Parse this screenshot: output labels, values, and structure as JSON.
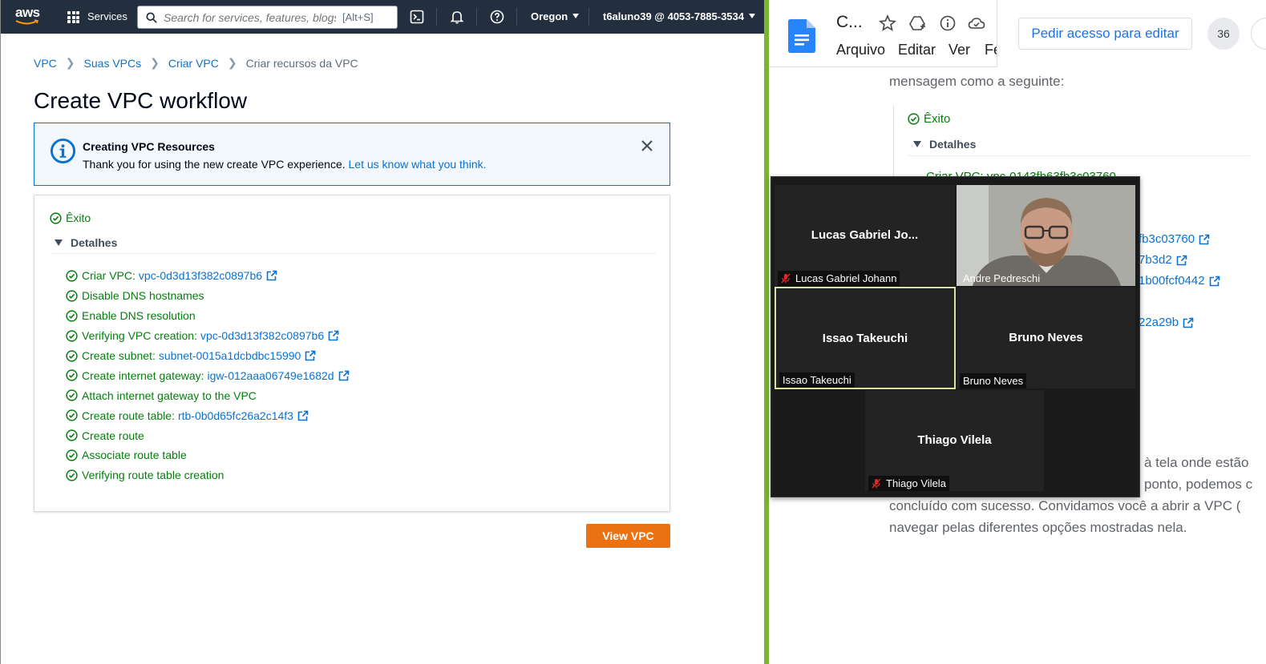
{
  "aws_nav": {
    "logo_text": "aws",
    "services": "Services",
    "search_placeholder": "Search for services, features, blogs, docs",
    "search_shortcut": "[Alt+S]",
    "region": "Oregon",
    "account": "t6aluno39 @ 4053-7885-3534"
  },
  "breadcrumb": {
    "items": [
      "VPC",
      "Suas VPCs",
      "Criar VPC"
    ],
    "current": "Criar recursos da VPC"
  },
  "page_title": "Create VPC workflow",
  "flash": {
    "title": "Creating VPC Resources",
    "body": "Thank you for using the new create VPC experience. ",
    "link": "Let us know what you think."
  },
  "result": {
    "status": "Êxito",
    "details_label": "Detalhes",
    "steps": [
      {
        "text": "Criar VPC:",
        "link": "vpc-0d3d13f382c0897b6"
      },
      {
        "text": "Disable DNS hostnames",
        "link": ""
      },
      {
        "text": "Enable DNS resolution",
        "link": ""
      },
      {
        "text": "Verifying VPC creation:",
        "link": "vpc-0d3d13f382c0897b6"
      },
      {
        "text": "Create subnet:",
        "link": "subnet-0015a1dcbdbc15990"
      },
      {
        "text": "Create internet gateway:",
        "link": "igw-012aaa06749e1682d"
      },
      {
        "text": "Attach internet gateway to the VPC",
        "link": ""
      },
      {
        "text": "Create route table:",
        "link": "rtb-0b0d65fc26a2c14f3"
      },
      {
        "text": "Create route",
        "link": ""
      },
      {
        "text": "Associate route table",
        "link": ""
      },
      {
        "text": "Verifying route table creation",
        "link": ""
      }
    ]
  },
  "view_vpc_button": "View VPC",
  "docs": {
    "title": "C...",
    "menu": [
      "Arquivo",
      "Editar",
      "Ver",
      "Fe"
    ],
    "request_edit": "Pedir acesso para editar",
    "count": "36",
    "line1": "mensagem como a seguinte:",
    "success": "Êxito",
    "details": "Detalhes",
    "cut_link": "Criar VPC: vpc-0143fb63fb3c03760",
    "links": [
      "fb3c03760",
      "7b3d2",
      "1b00fcf0442",
      "22a29b"
    ],
    "para_right_1": "à tela onde estão",
    "para_right_2": "ponto, podemos c",
    "para_line_3": "concluído com sucesso. Convidamos você a abrir a VPC (",
    "para_line_4": "navegar pelas diferentes opções mostradas nela."
  },
  "zoom": {
    "participants": [
      {
        "name": "Lucas Gabriel Jo...",
        "label": "Lucas Gabriel Johann",
        "muted": true
      },
      {
        "name": "",
        "label": "Andre Pedreschi",
        "muted": false
      },
      {
        "name": "Issao Takeuchi",
        "label": "Issao Takeuchi",
        "muted": false
      },
      {
        "name": "Bruno Neves",
        "label": "Bruno Neves",
        "muted": false
      },
      {
        "name": "Thiago Vilela",
        "label": "Thiago Vilela",
        "muted": true
      }
    ]
  },
  "colors": {
    "aws_nav_bg": "#232f3e",
    "aws_link": "#0972d3",
    "success_green": "#037f0c",
    "primary_orange": "#ec7211",
    "divider_green": "#79b432",
    "docs_blue": "#1a73e8",
    "zoom_active_border": "#d6e79e"
  }
}
